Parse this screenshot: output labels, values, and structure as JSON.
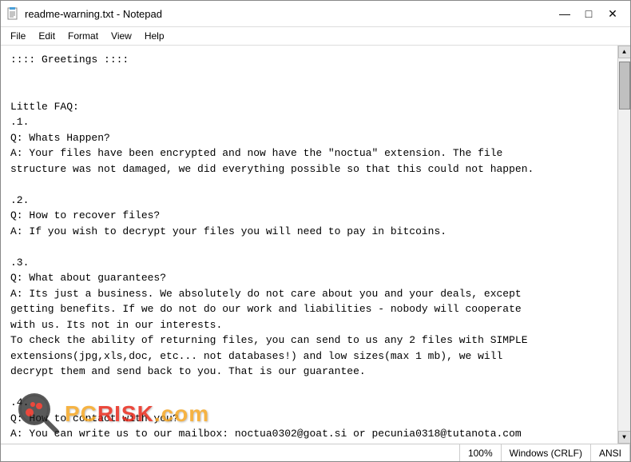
{
  "window": {
    "title": "readme-warning.txt - Notepad",
    "icon": "notepad"
  },
  "menu": {
    "items": [
      "File",
      "Edit",
      "Format",
      "View",
      "Help"
    ]
  },
  "content": {
    "text": ":::: Greetings ::::\n\n\nLittle FAQ:\n.1.\nQ: Whats Happen?\nA: Your files have been encrypted and now have the \"noctua\" extension. The file\nstructure was not damaged, we did everything possible so that this could not happen.\n\n.2.\nQ: How to recover files?\nA: If you wish to decrypt your files you will need to pay in bitcoins.\n\n.3.\nQ: What about guarantees?\nA: Its just a business. We absolutely do not care about you and your deals, except\ngetting benefits. If we do not do our work and liabilities - nobody will cooperate\nwith us. Its not in our interests.\nTo check the ability of returning files, you can send to us any 2 files with SIMPLE\nextensions(jpg,xls,doc, etc... not databases!) and low sizes(max 1 mb), we will\ndecrypt them and send back to you. That is our guarantee.\n\n.4.\nQ: How to contact with you?\nA: You can write us to our mailbox: noctua0302@goat.si or pecunia0318@tutanota.com"
  },
  "status_bar": {
    "zoom": "100%",
    "line_ending": "Windows (CRLF)",
    "encoding": "ANSI"
  },
  "watermark": {
    "text_pc": "PC",
    "text_risk": "RISK",
    "text_com": ".com"
  },
  "controls": {
    "minimize": "—",
    "maximize": "□",
    "close": "✕"
  }
}
